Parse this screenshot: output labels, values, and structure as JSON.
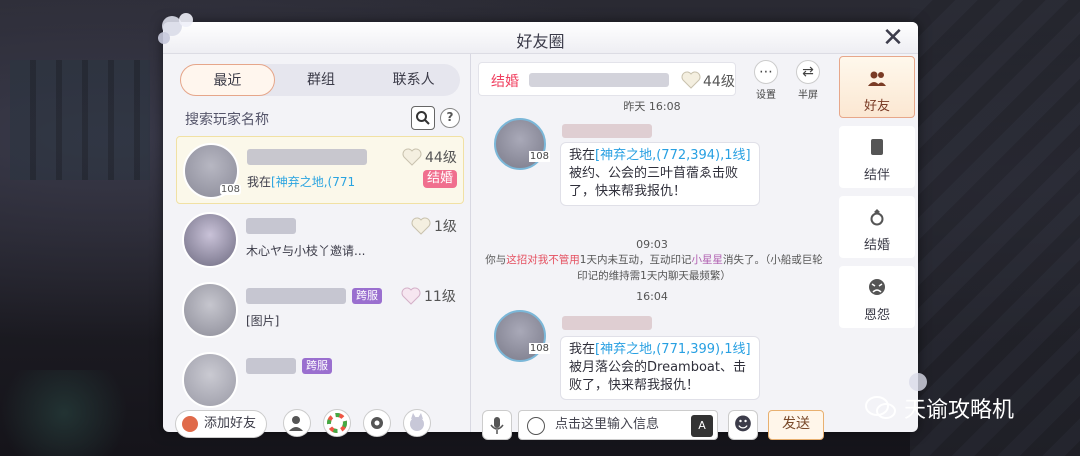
{
  "window": {
    "title": "好友圈"
  },
  "tabs": [
    {
      "label": "最近",
      "active": true
    },
    {
      "label": "群组",
      "active": false
    },
    {
      "label": "联系人",
      "active": false
    }
  ],
  "search": {
    "placeholder": "搜索玩家名称"
  },
  "friends": [
    {
      "level": "44级",
      "message_prefix": "我在",
      "message_link": "[神弃之地,(771",
      "badge": "结婚",
      "avatar_level": "108"
    },
    {
      "level": "1级",
      "message": "木心ヤ与小枝丫邀请..."
    },
    {
      "level": "11级",
      "message": "[图片]",
      "badge": "跨服"
    },
    {
      "badge": "跨服"
    }
  ],
  "left_bottom": {
    "add_friend": "添加好友"
  },
  "chat": {
    "header_tag": "结婚",
    "header_level": "44级",
    "tools": [
      {
        "icon": "more-icon",
        "label": "设置"
      },
      {
        "icon": "swap-icon",
        "label": "半屏"
      }
    ],
    "top_time": "昨天 16:08",
    "messages": [
      {
        "avatar_level": "108",
        "line1_prefix": "我在",
        "line1_link": "[神弃之地,(772,394),1线]",
        "line2": "被约、公会的三叶苜蓿ゑ击败了，快来帮我报仇！"
      },
      {
        "avatar_level": "108",
        "line1_prefix": "我在",
        "line1_link": "[神弃之地,(771,399),1线]",
        "line2": "被月落公会的Dreamboat、击败了，快来帮我报仇！"
      }
    ],
    "time2": "09:03",
    "system": {
      "p1": "你与",
      "red": "这招对我不管用",
      "p2": "1天内未互动，互动印记",
      "purple": "小星星",
      "p3": "消失了。（小船或巨轮",
      "line2": "印记的维持需1天内聊天最频繁）"
    },
    "time3": "16:04",
    "input_placeholder": "点击这里输入信息",
    "send": "发送"
  },
  "side": [
    {
      "label": "好友",
      "active": true,
      "icon": "friends-icon"
    },
    {
      "label": "结伴",
      "active": false,
      "icon": "book-icon"
    },
    {
      "label": "结婚",
      "active": false,
      "icon": "ring-icon"
    },
    {
      "label": "恩怨",
      "active": false,
      "icon": "angry-face-icon"
    }
  ],
  "watermark": "天谕攻略机"
}
